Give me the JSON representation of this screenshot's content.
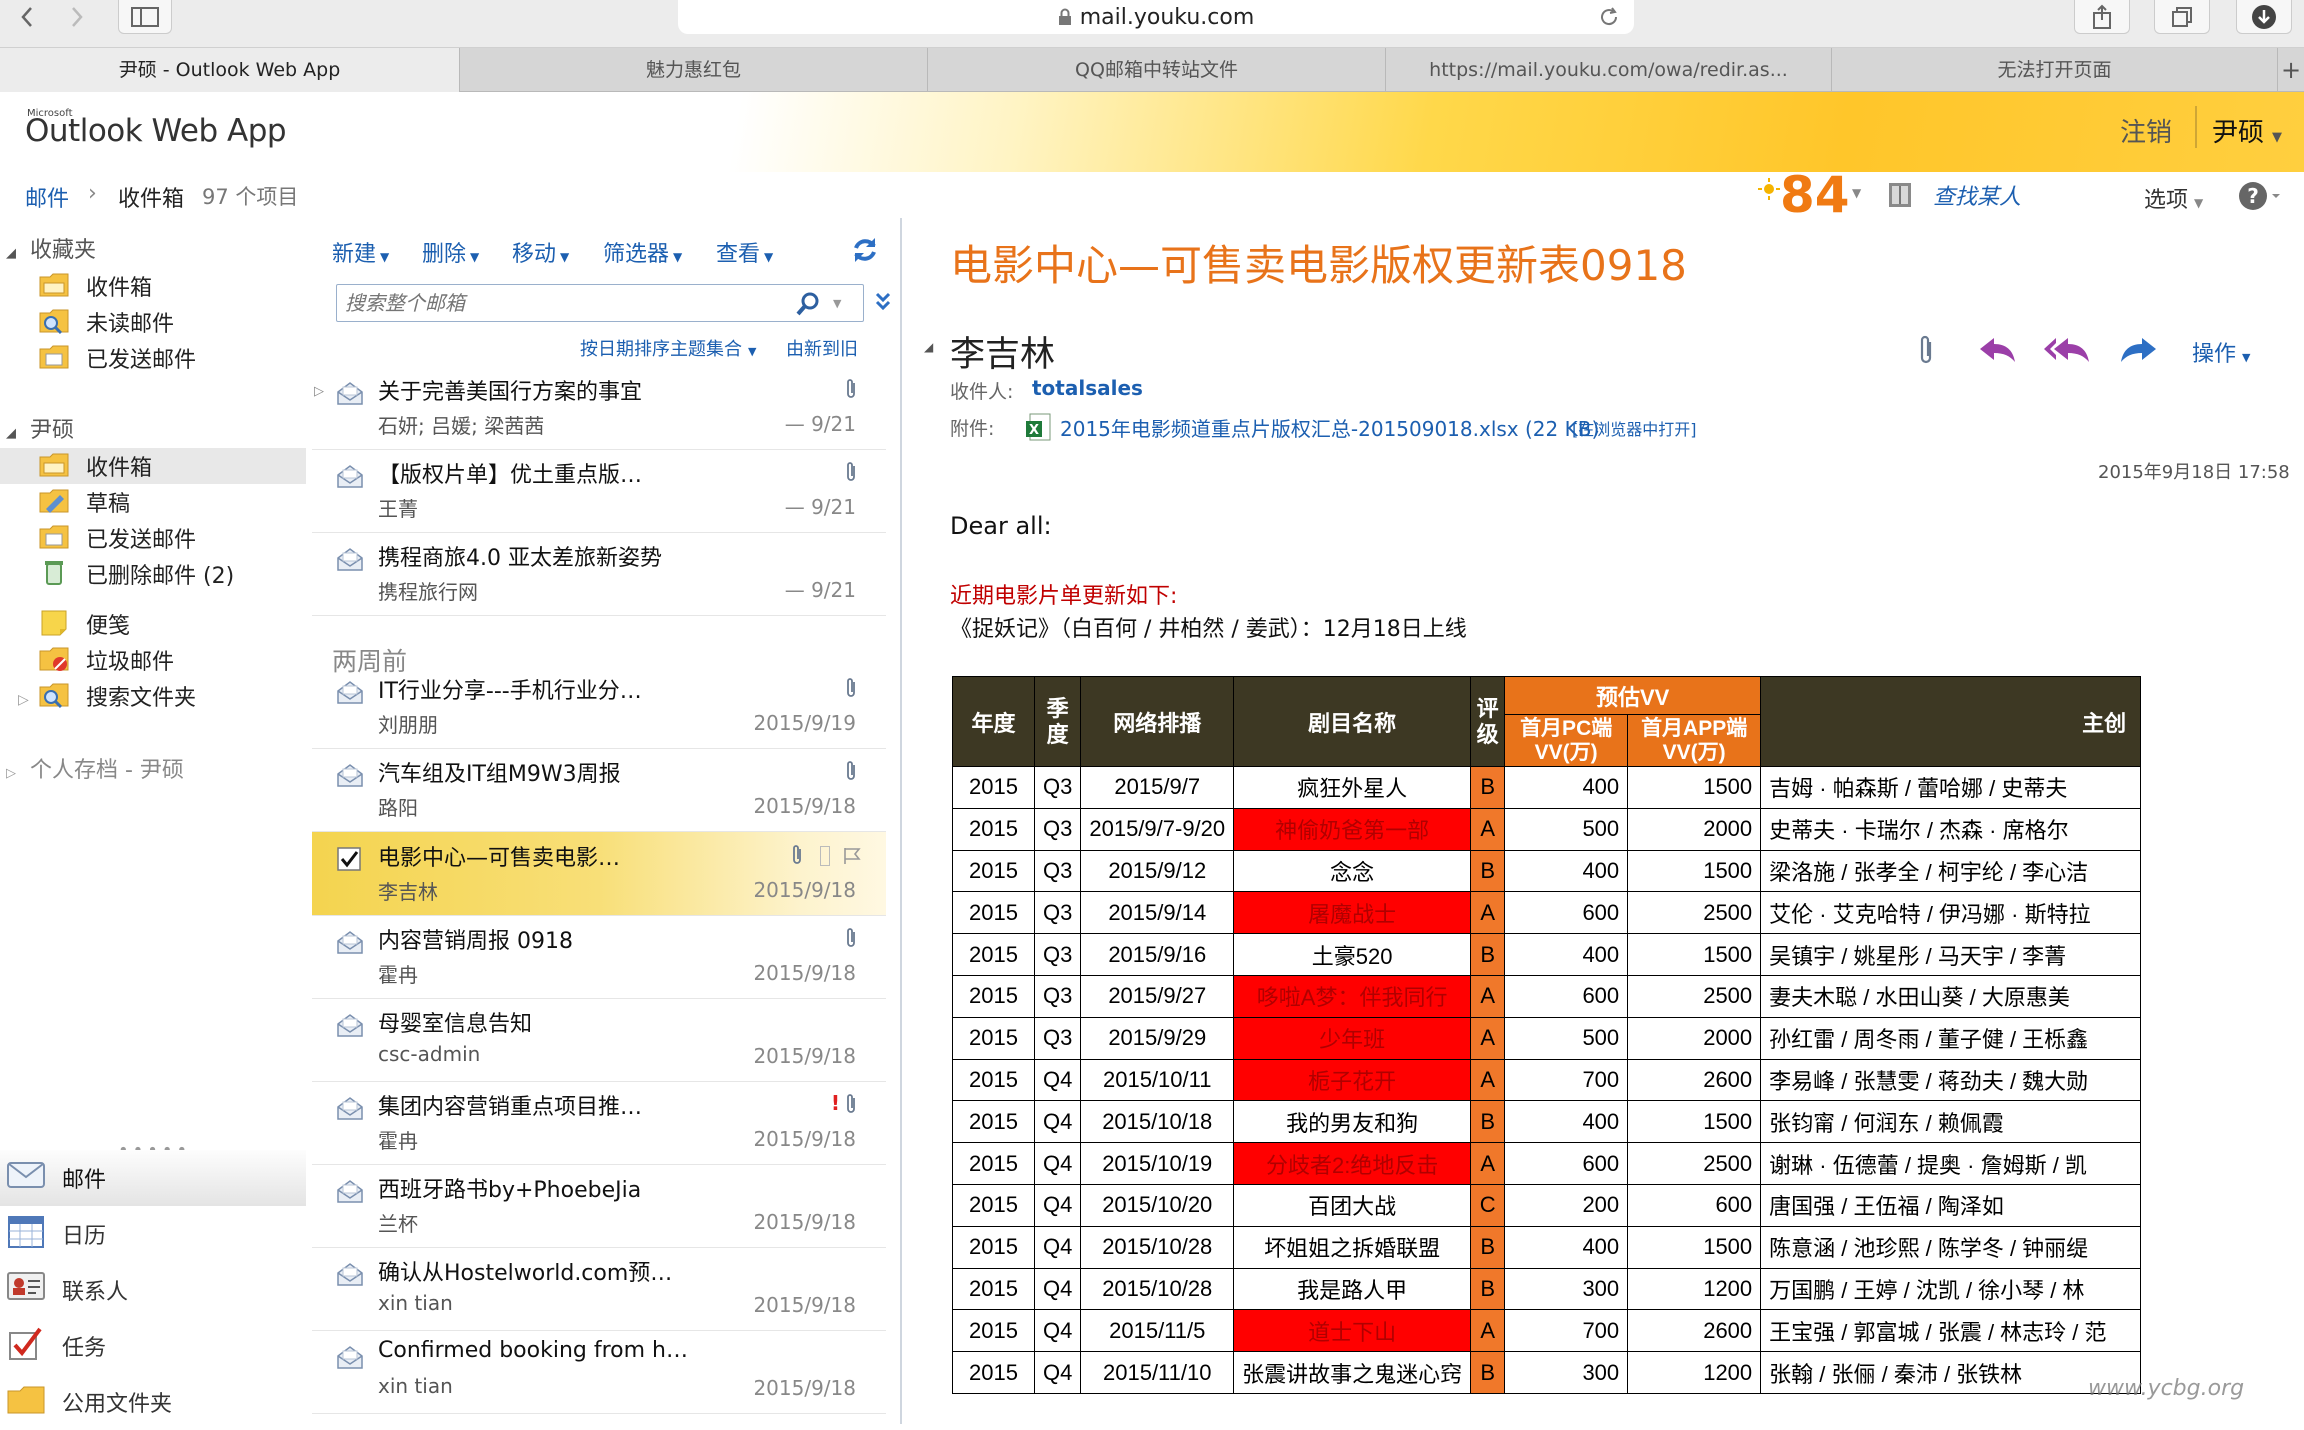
{
  "browser": {
    "url": "mail.youku.com",
    "tabs": [
      "尹硕 - Outlook Web App",
      "魅力惠红包",
      "QQ邮箱中转站文件",
      "https://mail.youku.com/owa/redir.as...",
      "无法打开页面"
    ],
    "new_tab": "+"
  },
  "header": {
    "logo_small": "Microsoft",
    "logo": "Outlook Web App",
    "logout": "注销",
    "user": "尹硕"
  },
  "breadcrumb": {
    "mail": "邮件",
    "sep": "›",
    "folder": "收件箱",
    "count": "97 个项目"
  },
  "topright": {
    "score": "84",
    "find_person": "查找某人",
    "options": "选项"
  },
  "folders": {
    "favorites_label": "收藏夹",
    "favorites": [
      "收件箱",
      "未读邮件",
      "已发送邮件"
    ],
    "mailbox_label": "尹硕",
    "mailbox": [
      "收件箱",
      "草稿",
      "已发送邮件",
      "已删除邮件 (2)"
    ],
    "mailbox_extra": [
      "便笺",
      "垃圾邮件",
      "搜索文件夹"
    ],
    "archive_label": "个人存档 - 尹硕"
  },
  "nav": [
    "邮件",
    "日历",
    "联系人",
    "任务",
    "公用文件夹"
  ],
  "toolbar": {
    "new": "新建",
    "delete": "删除",
    "move": "移动",
    "filter": "筛选器",
    "view": "查看"
  },
  "search": {
    "placeholder": "搜索整个邮箱"
  },
  "sort": {
    "by": "按日期排序主题集合",
    "order": "由新到旧"
  },
  "group_label": "两周前",
  "messages": [
    {
      "subject": "关于完善美国行方案的事宜",
      "from": "石妍; 吕媛; 梁茜茜",
      "date": "— 9/21"
    },
    {
      "subject": "【版权片单】优土重点版…",
      "from": "王菁",
      "date": "— 9/21"
    },
    {
      "subject": "携程商旅4.0 亚太差旅新姿势",
      "from": "携程旅行网",
      "date": "— 9/21"
    },
    {
      "subject": "IT行业分享---手机行业分…",
      "from": "刘朋朋",
      "date": "2015/9/19"
    },
    {
      "subject": "汽车组及IT组M9W3周报",
      "from": "路阳",
      "date": "2015/9/18"
    },
    {
      "subject": "电影中心—可售卖电影…",
      "from": "李吉林",
      "date": "2015/9/18"
    },
    {
      "subject": "内容营销周报 0918",
      "from": "霍冉",
      "date": "2015/9/18"
    },
    {
      "subject": "母婴室信息告知",
      "from": "csc-admin",
      "date": "2015/9/18"
    },
    {
      "subject": "集团内容营销重点项目推…",
      "from": "霍冉",
      "date": "2015/9/18"
    },
    {
      "subject": "西班牙路书by+PhoebeJia",
      "from": "兰杯",
      "date": "2015/9/18"
    },
    {
      "subject": "确认从Hostelworld.com预…",
      "from": "xin tian",
      "date": "2015/9/18"
    },
    {
      "subject": "Confirmed booking from h…",
      "from": "xin tian",
      "date": "2015/9/18"
    }
  ],
  "reading": {
    "subject": "电影中心—可售卖电影版权更新表0918",
    "sender": "李吉林",
    "to_label": "收件人:",
    "to": "totalsales",
    "att_label": "附件:",
    "attachment": "2015年电影频道重点片版权汇总-201509018.xlsx (22 KB)",
    "att_open": "[在浏览器中打开]",
    "actions": "操作",
    "date": "2015年9月18日 17:58",
    "greeting": "Dear  all:",
    "intro": "近期电影片单更新如下:",
    "intro2": "《捉妖记》（白百何 / 井柏然 / 姜武）：12月18日上线"
  },
  "table": {
    "headers": {
      "year": "年度",
      "quarter": "季度",
      "schedule": "网络排播",
      "title": "剧目名称",
      "grade": "评级",
      "group": "预估VV",
      "pc": "首月PC端 VV(万)",
      "app": "首月APP端 VV(万)",
      "cast": "主创"
    },
    "rows": [
      [
        "2015",
        "Q3",
        "2015/9/7",
        "疯狂外星人",
        "B",
        "400",
        "1500",
        "吉姆 · 帕森斯 / 蕾哈娜 / 史蒂夫"
      ],
      [
        "2015",
        "Q3",
        "2015/9/7-9/20",
        "神偷奶爸第一部",
        "A",
        "500",
        "2000",
        "史蒂夫 · 卡瑞尔 / 杰森 · 席格尔"
      ],
      [
        "2015",
        "Q3",
        "2015/9/12",
        "念念",
        "B",
        "400",
        "1500",
        "梁洛施 / 张孝全 / 柯宇纶 / 李心洁"
      ],
      [
        "2015",
        "Q3",
        "2015/9/14",
        "屠魔战士",
        "A",
        "600",
        "2500",
        "艾伦 · 艾克哈特 / 伊冯娜 · 斯特拉"
      ],
      [
        "2015",
        "Q3",
        "2015/9/16",
        "土豪520",
        "B",
        "400",
        "1500",
        "吴镇宇 / 姚星彤 / 马天宇 / 李菁"
      ],
      [
        "2015",
        "Q3",
        "2015/9/27",
        "哆啦A梦：伴我同行",
        "A",
        "600",
        "2500",
        "妻夫木聪 / 水田山葵 / 大原惠美"
      ],
      [
        "2015",
        "Q3",
        "2015/9/29",
        "少年班",
        "A",
        "500",
        "2000",
        "孙红雷 / 周冬雨 / 董子健 / 王栎鑫"
      ],
      [
        "2015",
        "Q4",
        "2015/10/11",
        "栀子花开",
        "A",
        "700",
        "2600",
        "李易峰 / 张慧雯 / 蒋劲夫 / 魏大勋"
      ],
      [
        "2015",
        "Q4",
        "2015/10/18",
        "我的男友和狗",
        "B",
        "400",
        "1500",
        "张钧甯 / 何润东 / 赖佩霞"
      ],
      [
        "2015",
        "Q4",
        "2015/10/19",
        "分歧者2:绝地反击",
        "A",
        "600",
        "2500",
        "谢琳 · 伍德蕾 / 提奥 · 詹姆斯 / 凯"
      ],
      [
        "2015",
        "Q4",
        "2015/10/20",
        "百团大战",
        "C",
        "200",
        "600",
        "唐国强 / 王伍福 / 陶泽如"
      ],
      [
        "2015",
        "Q4",
        "2015/10/28",
        "坏姐姐之拆婚联盟",
        "B",
        "400",
        "1500",
        "陈意涵 / 池珍熙 / 陈学冬 / 钟丽缇"
      ],
      [
        "2015",
        "Q4",
        "2015/10/28",
        "我是路人甲",
        "B",
        "300",
        "1200",
        "万国鹏 / 王婷 / 沈凯 / 徐小琴 / 林"
      ],
      [
        "2015",
        "Q4",
        "2015/11/5",
        "道士下山",
        "A",
        "700",
        "2600",
        "王宝强 / 郭富城 / 张震 / 林志玲 / 范"
      ],
      [
        "2015",
        "Q4",
        "2015/11/10",
        "张震讲故事之鬼迷心窍",
        "B",
        "300",
        "1200",
        "张翰 / 张俪 / 秦沛 / 张铁林"
      ]
    ],
    "highlight_rows": [
      1,
      3,
      5,
      6,
      7,
      9,
      13
    ]
  },
  "watermark": "www.ycbg.org"
}
